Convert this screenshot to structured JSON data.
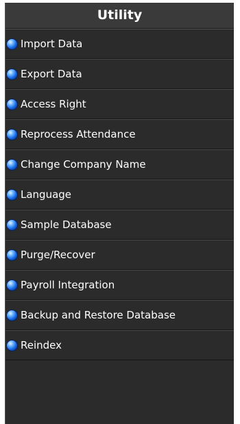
{
  "panel": {
    "title": "Utility",
    "items": [
      {
        "label": "Import Data",
        "icon": "blue-bullet-icon"
      },
      {
        "label": "Export Data",
        "icon": "blue-bullet-icon"
      },
      {
        "label": "Access Right",
        "icon": "blue-bullet-icon"
      },
      {
        "label": "Reprocess Attendance",
        "icon": "blue-bullet-icon"
      },
      {
        "label": "Change Company Name",
        "icon": "blue-bullet-icon"
      },
      {
        "label": "Language",
        "icon": "blue-bullet-icon"
      },
      {
        "label": "Sample Database",
        "icon": "blue-bullet-icon"
      },
      {
        "label": "Purge/Recover",
        "icon": "blue-bullet-icon"
      },
      {
        "label": "Payroll Integration",
        "icon": "blue-bullet-icon"
      },
      {
        "label": "Backup and Restore Database",
        "icon": "blue-bullet-icon"
      },
      {
        "label": "Reindex",
        "icon": "blue-bullet-icon"
      }
    ]
  },
  "colors": {
    "panel_background": "#2b2b2b",
    "header_background": "#3a3a3a",
    "text": "#ffffff",
    "bullet": "#1060e0"
  }
}
